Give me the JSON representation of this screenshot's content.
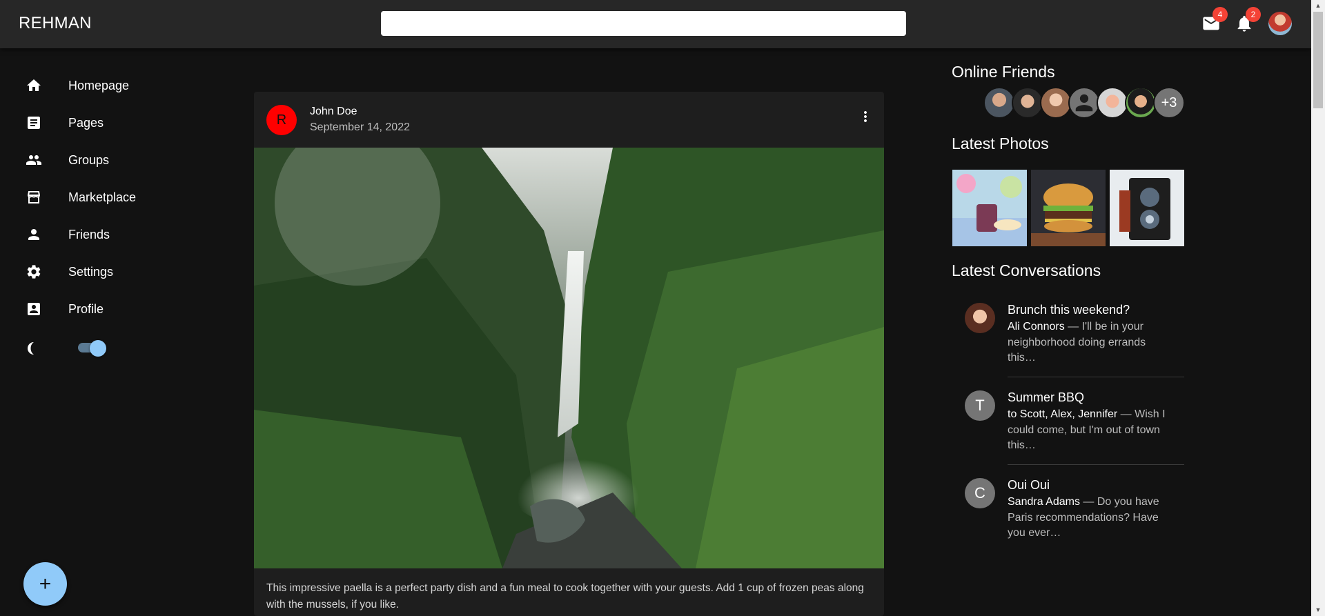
{
  "app": {
    "title": "REHMAN"
  },
  "search": {
    "placeholder": ""
  },
  "header": {
    "mail_badge": "4",
    "notifications_badge": "2"
  },
  "sidebar": {
    "items": [
      {
        "label": "Homepage",
        "icon": "home-icon"
      },
      {
        "label": "Pages",
        "icon": "article-icon"
      },
      {
        "label": "Groups",
        "icon": "group-icon"
      },
      {
        "label": "Marketplace",
        "icon": "storefront-icon"
      },
      {
        "label": "Friends",
        "icon": "person-icon"
      },
      {
        "label": "Settings",
        "icon": "gear-icon"
      },
      {
        "label": "Profile",
        "icon": "account-box-icon"
      }
    ],
    "dark_mode_enabled": true
  },
  "fab": {
    "label": "+"
  },
  "post": {
    "avatar_letter": "R",
    "author": "John Doe",
    "date": "September 14, 2022",
    "image": "waterfall in a lush green jungle",
    "text": "This impressive paella is a perfect party dish and a fun meal to cook together with your guests. Add 1 cup of frozen peas along with the mussels, if you like."
  },
  "right_panel": {
    "online_friends_title": "Online Friends",
    "more_friends": "+3",
    "latest_photos_title": "Latest Photos",
    "latest_conversations_title": "Latest Conversations",
    "conversations": [
      {
        "title": "Brunch this weekend?",
        "who": "Ali Connors",
        "text": " — I'll be in your neighborhood doing errands this…",
        "avatar": ""
      },
      {
        "title": "Summer BBQ",
        "who": "to Scott, Alex, Jennifer",
        "text": " — Wish I could come, but I'm out of town this…",
        "avatar": "T"
      },
      {
        "title": "Oui Oui",
        "who": "Sandra Adams",
        "text": " — Do you have Paris recommendations? Have you ever…",
        "avatar": "C"
      }
    ]
  },
  "colors": {
    "accent": "#90caf9",
    "badge": "#f44336",
    "app_bar": "#272727",
    "background": "#121212",
    "card": "#1e1e1e"
  }
}
